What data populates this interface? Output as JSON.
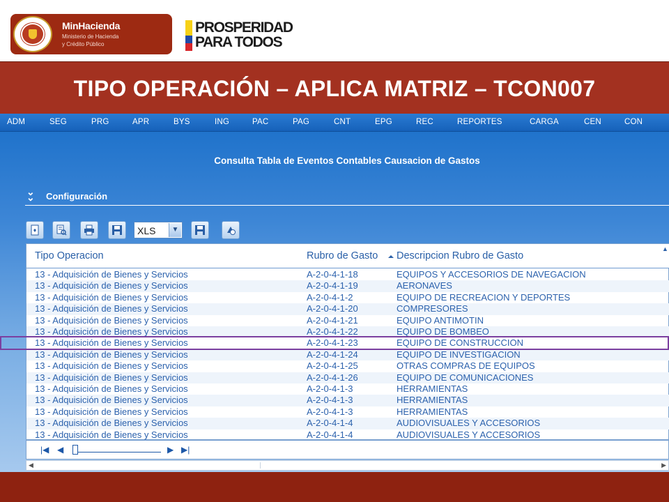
{
  "header": {
    "minhacienda": {
      "title": "MinHacienda",
      "subtitle_line1": "Ministerio de Hacienda",
      "subtitle_line2": "y Crédito Público",
      "seal_icon": "colombia-coat-of-arms-seal-icon"
    },
    "prosperidad": {
      "line1": "PROSPERIDAD",
      "line2": "PARA TODOS",
      "flag_colors": [
        "#f7d117",
        "#1f4aa8",
        "#d8262b"
      ]
    }
  },
  "slide_title": "TIPO OPERACIÓN – APLICA MATRIZ – TCON007",
  "menu": {
    "items": [
      "ADM",
      "SEG",
      "PRG",
      "APR",
      "BYS",
      "ING",
      "PAC",
      "PAG",
      "CNT",
      "EPG",
      "REC",
      "REPORTES",
      "CARGA",
      "CEN",
      "CON"
    ]
  },
  "page_heading": "Consulta Tabla de Eventos Contables Causacion de Gastos",
  "config": {
    "label": "Configuración",
    "icon": "double-chevron-down-icon"
  },
  "toolbar": {
    "buttons": [
      "new-document-icon",
      "search-document-icon",
      "print-icon",
      "save-icon",
      "export-save-icon",
      "refresh-icon"
    ],
    "format_select": {
      "value": "XLS"
    }
  },
  "grid": {
    "columns": [
      "Tipo Operacion",
      "Rubro de Gasto",
      "Descripcion Rubro de Gasto"
    ],
    "sorted_column": "Rubro de Gasto",
    "rows": [
      [
        "13 - Adquisición de Bienes y Servicios",
        "A-2-0-4-1-18",
        "EQUIPOS Y ACCESORIOS DE NAVEGACION"
      ],
      [
        "13 - Adquisición de Bienes y Servicios",
        "A-2-0-4-1-19",
        "AERONAVES"
      ],
      [
        "13 - Adquisición de Bienes y Servicios",
        "A-2-0-4-1-2",
        "EQUIPO DE RECREACION Y DEPORTES"
      ],
      [
        "13 - Adquisición de Bienes y Servicios",
        "A-2-0-4-1-20",
        "COMPRESORES"
      ],
      [
        "13 - Adquisición de Bienes y Servicios",
        "A-2-0-4-1-21",
        "EQUIPO ANTIMOTIN"
      ],
      [
        "13 - Adquisición de Bienes y Servicios",
        "A-2-0-4-1-22",
        "EQUIPO DE BOMBEO"
      ],
      [
        "13 - Adquisición de Bienes y Servicios",
        "A-2-0-4-1-23",
        "EQUIPO DE CONSTRUCCION"
      ],
      [
        "13 - Adquisición de Bienes y Servicios",
        "A-2-0-4-1-24",
        "EQUIPO DE INVESTIGACION"
      ],
      [
        "13 - Adquisición de Bienes y Servicios",
        "A-2-0-4-1-25",
        "OTRAS COMPRAS DE EQUIPOS"
      ],
      [
        "13 - Adquisición de Bienes y Servicios",
        "A-2-0-4-1-26",
        "EQUIPO DE COMUNICACIONES"
      ],
      [
        "13 - Adquisición de Bienes y Servicios",
        "A-2-0-4-1-3",
        "HERRAMIENTAS"
      ],
      [
        "13 - Adquisición de Bienes y Servicios",
        "A-2-0-4-1-3",
        "HERRAMIENTAS"
      ],
      [
        "13 - Adquisición de Bienes y Servicios",
        "A-2-0-4-1-3",
        "HERRAMIENTAS"
      ],
      [
        "13 - Adquisición de Bienes y Servicios",
        "A-2-0-4-1-4",
        "AUDIOVISUALES Y ACCESORIOS"
      ],
      [
        "13 - Adquisición de Bienes y Servicios",
        "A-2-0-4-1-4",
        "AUDIOVISUALES Y ACCESORIOS"
      ]
    ],
    "highlighted_row": 6,
    "highlight_color": "#7b3fa0"
  },
  "pager": {
    "icons": [
      "first-page-icon",
      "previous-page-icon",
      "next-page-icon",
      "last-page-icon"
    ]
  },
  "colors": {
    "brand_red": "#a33120",
    "footer_red": "#8e2210",
    "app_blue": "#1a6fc9",
    "grid_text": "#2c62ad"
  }
}
